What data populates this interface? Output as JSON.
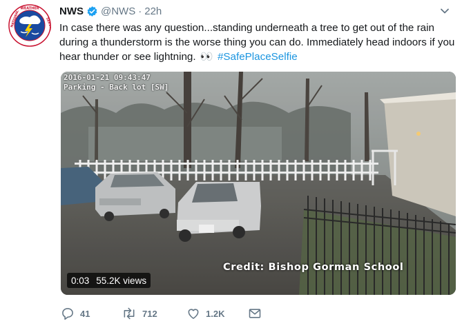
{
  "tweet": {
    "author_name": "NWS",
    "handle": "@NWS",
    "separator": "·",
    "time": "22h",
    "text_main": "In case there was any question...standing underneath a tree to get out of the rain during a thunderstorm is the worse thing you can do. Immediately head indoors if you hear thunder or see lightning.",
    "emoji": "👀",
    "hashtag": "#SafePlaceSelfie"
  },
  "media": {
    "camera_timestamp": "2016-01-21 09:43:47",
    "camera_location": "Parking - Back lot [SW]",
    "credit": "Credit: Bishop Gorman School",
    "video_duration": "0:03",
    "video_views": "55.2K views"
  },
  "actions": {
    "reply_count": "41",
    "retweet_count": "712",
    "like_count": "1.2K"
  },
  "colors": {
    "text": "#14171a",
    "secondary": "#657786",
    "link": "#1b95e0",
    "verified": "#1da1f2"
  },
  "icons": [
    "nws-logo-avatar",
    "verified-badge-icon",
    "chevron-down-icon",
    "reply-icon",
    "retweet-icon",
    "like-icon",
    "direct-message-icon"
  ]
}
